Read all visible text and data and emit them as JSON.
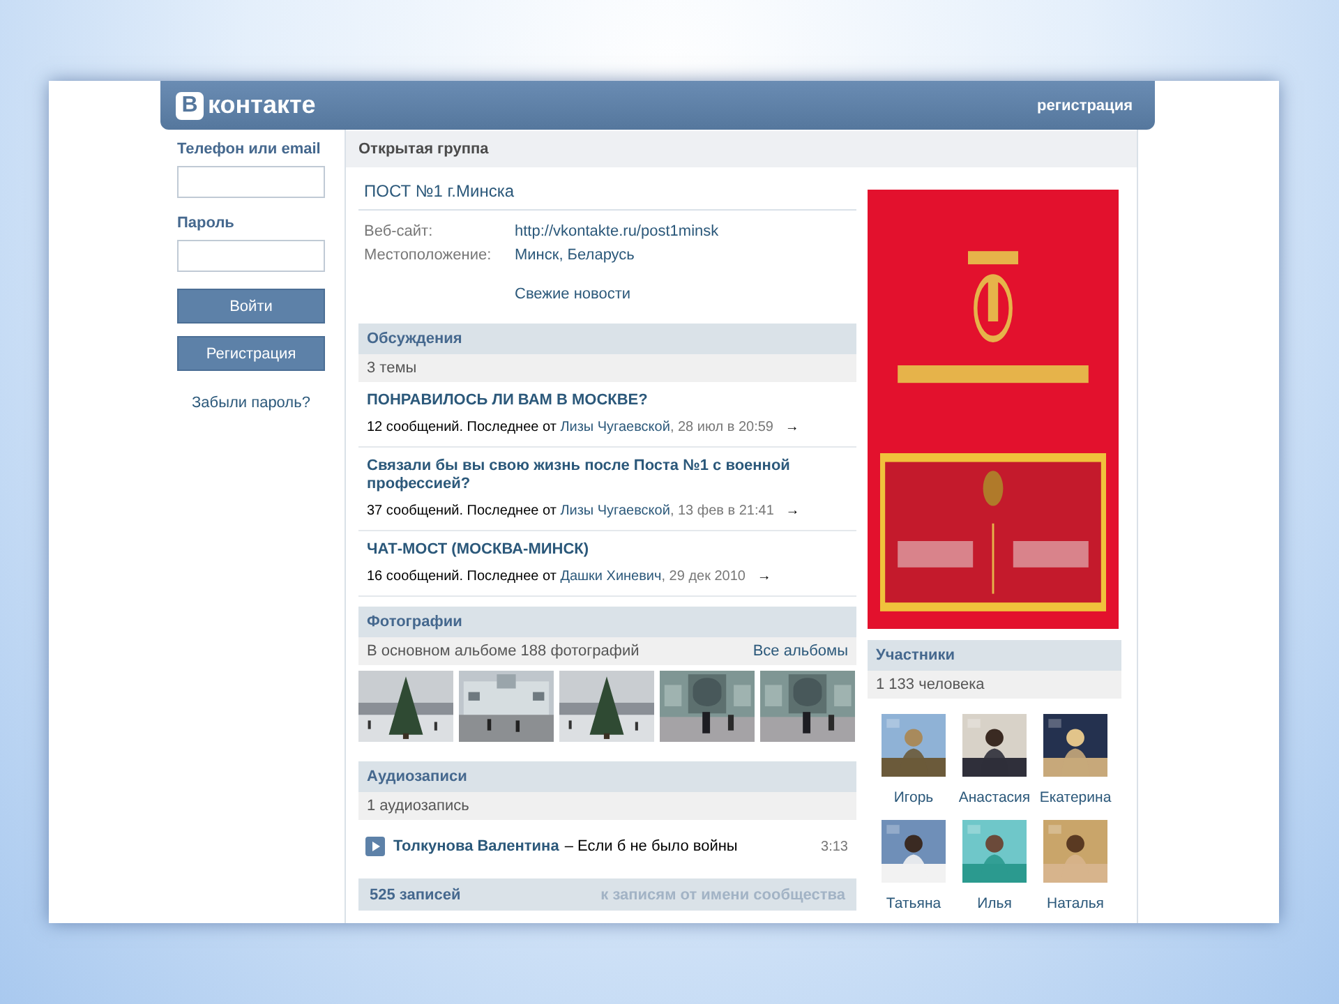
{
  "header": {
    "logo_badge": "В",
    "logo_text": "контакте",
    "register_link": "регистрация"
  },
  "login": {
    "phone_label": "Телефон или email",
    "password_label": "Пароль",
    "login_button": "Войти",
    "register_button": "Регистрация",
    "forgot_link": "Забыли пароль?"
  },
  "group": {
    "type_label": "Открытая группа",
    "title": "ПОСТ №1 г.Минска",
    "info": [
      {
        "label": "Веб-сайт:",
        "value": "http://vkontakte.ru/post1minsk"
      },
      {
        "label": "Местоположение:",
        "value": "Минск, Беларусь"
      }
    ],
    "news_link": "Свежие новости"
  },
  "discussions": {
    "title": "Обсуждения",
    "count": "3 темы",
    "topics": [
      {
        "title": "ПОНРАВИЛОСЬ ЛИ ВАМ В МОСКВЕ?",
        "meta": "12 сообщений. Последнее от",
        "author": "Лизы Чугаевской",
        "date": ", 28 июл в 20:59",
        "arrow": "→"
      },
      {
        "title": "Связали бы вы свою жизнь после Поста №1 с военной профессией?",
        "meta": "37 сообщений. Последнее от",
        "author": "Лизы Чугаевской",
        "date": ", 13 фев в 21:41",
        "arrow": "→"
      },
      {
        "title": "ЧАТ-МОСТ (МОСКВА-МИНСК)",
        "meta": "16 сообщений. Последнее от",
        "author": "Дашки Хиневич",
        "date": ", 29 дек 2010",
        "arrow": "→"
      }
    ]
  },
  "photos": {
    "title": "Фотографии",
    "caption": "В основном альбоме 188 фотографий",
    "all_link": "Все альбомы"
  },
  "audio": {
    "title": "Аудиозаписи",
    "count": "1 аудиозапись",
    "tracks": [
      {
        "artist": "Толкунова Валентина",
        "song": "– Если б не было войны",
        "duration": "3:13"
      }
    ]
  },
  "wall": {
    "count": "525 записей",
    "community_link": "к записям от имени сообщества"
  },
  "side": {
    "members": {
      "title": "Участники",
      "count": "1 133 человека",
      "people": [
        {
          "name": "Игорь"
        },
        {
          "name": "Анастасия"
        },
        {
          "name": "Екатерина"
        },
        {
          "name": "Татьяна"
        },
        {
          "name": "Илья"
        },
        {
          "name": "Наталья"
        }
      ]
    }
  }
}
